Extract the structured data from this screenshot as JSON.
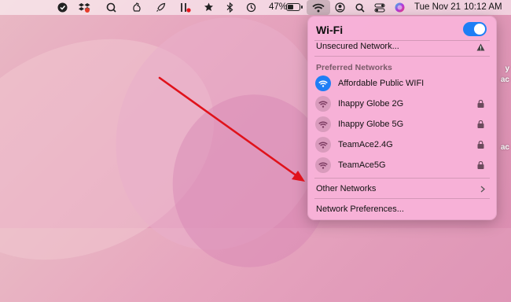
{
  "menubar": {
    "battery_percent": "47%",
    "battery_level": 0.47,
    "date": "Tue Nov 21",
    "time": "10:12 AM"
  },
  "wifi_menu": {
    "title": "Wi-Fi",
    "toggle_on": true,
    "unsecured": "Unsecured Network...",
    "preferred_header": "Preferred Networks",
    "networks": [
      {
        "name": "Affordable Public WIFI",
        "connected": true,
        "locked": false
      },
      {
        "name": "Ihappy Globe 2G",
        "connected": false,
        "locked": true
      },
      {
        "name": "Ihappy Globe 5G",
        "connected": false,
        "locked": true
      },
      {
        "name": "TeamAce2.4G",
        "connected": false,
        "locked": true
      },
      {
        "name": "TeamAce5G",
        "connected": false,
        "locked": true
      }
    ],
    "other_networks": "Other Networks",
    "preferences": "Network Preferences..."
  },
  "colors": {
    "accent": "#1e7ef5",
    "arrow": "#e0121b",
    "panel": "#f8b2d8"
  },
  "icons": [
    "apple-shield-icon",
    "dropbox-icon",
    "search-q-icon",
    "hand-icon",
    "rocket-icon",
    "tools-icon",
    "gear-star-icon",
    "bluetooth-icon",
    "time-machine-icon",
    "battery-icon",
    "wifi-icon",
    "user-icon",
    "spotlight-icon",
    "control-center-icon",
    "siri-icon"
  ]
}
